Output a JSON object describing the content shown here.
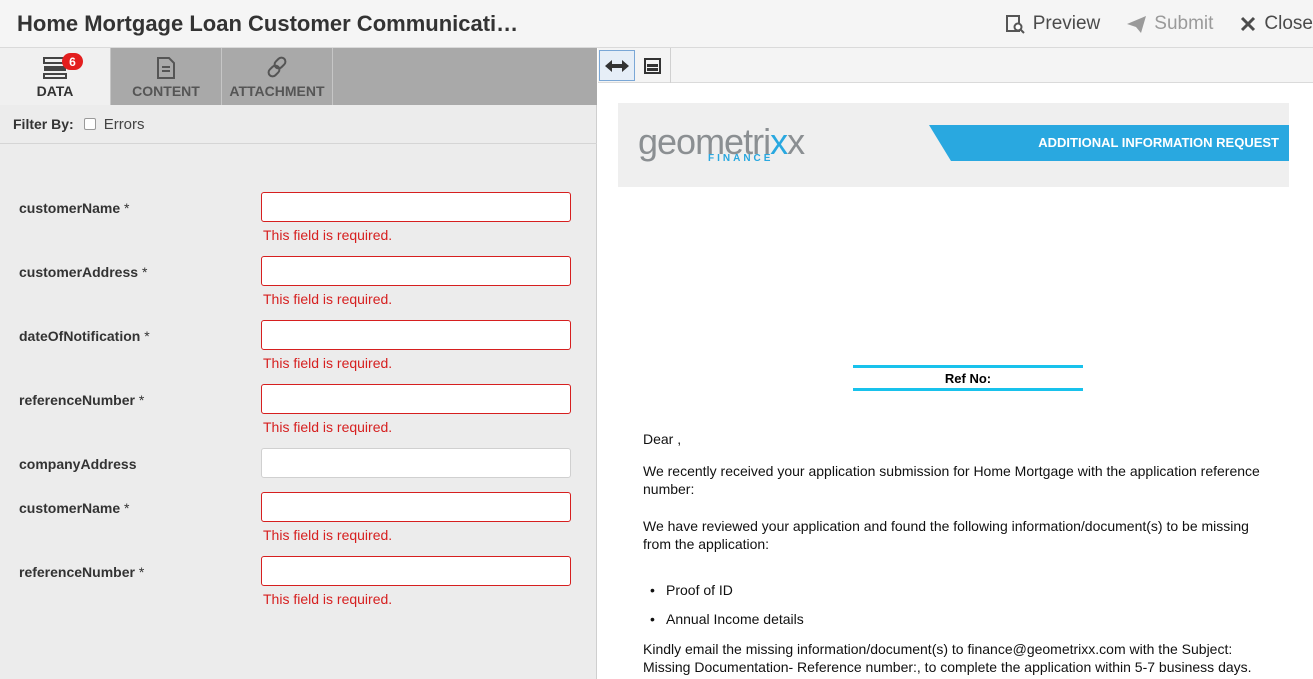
{
  "header": {
    "title": "Home Mortgage Loan Customer Communicati…",
    "preview_label": "Preview",
    "submit_label": "Submit",
    "close_label": "Close"
  },
  "tabs": [
    {
      "label": "DATA",
      "icon": "data-icon",
      "badge": "6",
      "active": true
    },
    {
      "label": "CONTENT",
      "icon": "document-icon"
    },
    {
      "label": "ATTACHMENT",
      "icon": "link-icon"
    }
  ],
  "filter": {
    "label": "Filter By:",
    "option": "Errors"
  },
  "fields": [
    {
      "label": "customerName",
      "required": "*",
      "error": "This field is required."
    },
    {
      "label": "customerAddress",
      "required": "*",
      "error": "This field is required."
    },
    {
      "label": "dateOfNotification",
      "required": "*",
      "error": "This field is required."
    },
    {
      "label": "referenceNumber",
      "required": "*",
      "error": "This field is required."
    },
    {
      "label": "companyAddress",
      "required": "",
      "error": ""
    },
    {
      "label": "customerName",
      "required": "*",
      "error": "This field is required."
    },
    {
      "label": "referenceNumber",
      "required": "*",
      "error": "This field is required."
    }
  ],
  "document": {
    "logo_text_a": "geometri",
    "logo_text_b": "x",
    "logo_text_c": "x",
    "logo_sub": "FINANCE",
    "banner_title": "ADDITIONAL INFORMATION REQUEST",
    "ref_label": "Ref No:",
    "greeting": "Dear ,",
    "para1": "We recently received your application submission for Home Mortgage with the application reference number:",
    "para2": "We have reviewed your application and found the following information/document(s) to be missing from the application:",
    "bullets": [
      "Proof of ID",
      "Annual Income details"
    ],
    "para3": "Kindly email the missing information/document(s) to finance@geometrixx.com with the Subject: Missing Documentation- Reference number:, to complete the application within 5-7 business days."
  },
  "colors": {
    "accent": "#29a8e0",
    "error": "#d61f1f",
    "badge": "#e31e1e",
    "ref_border": "#18c2ec"
  }
}
